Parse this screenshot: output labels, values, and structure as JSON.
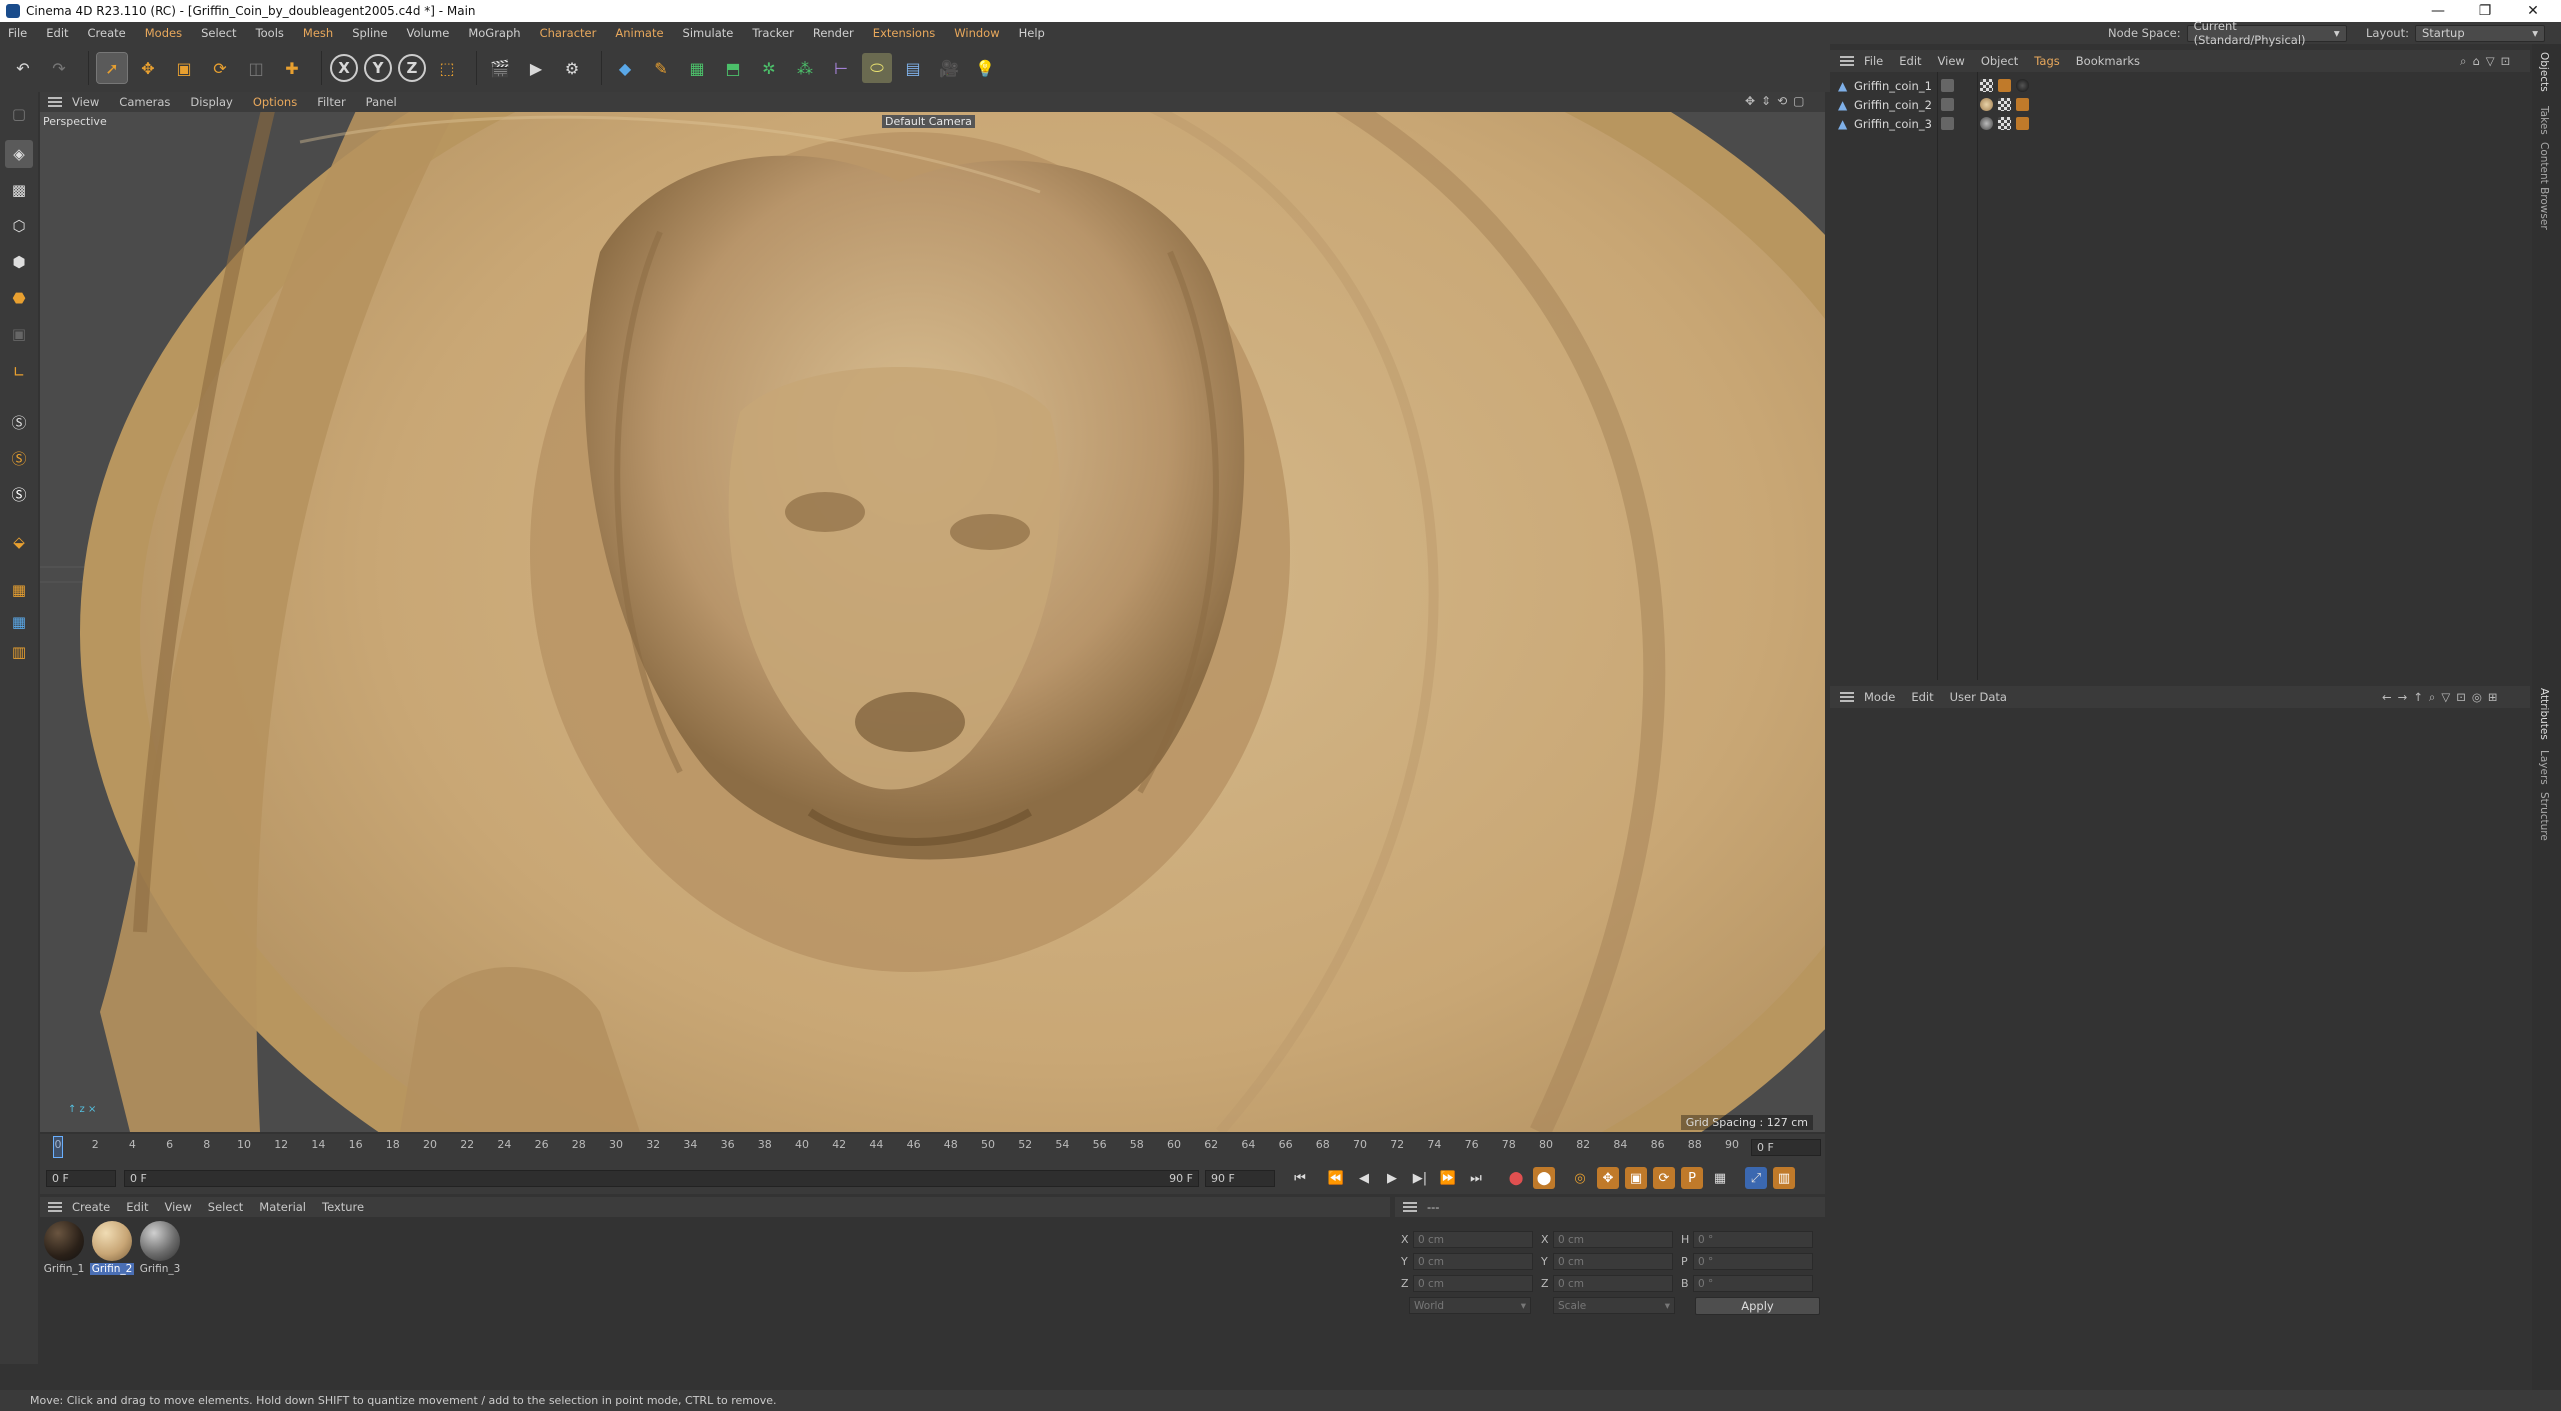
{
  "window": {
    "title": "Cinema 4D R23.110 (RC) - [Griffin_Coin_by_doubleagent2005.c4d *] - Main",
    "controls": {
      "minimize": "—",
      "restore": "❐",
      "close": "✕"
    }
  },
  "menubar": {
    "items": [
      "File",
      "Edit",
      "Create",
      "Modes",
      "Select",
      "Tools",
      "Mesh",
      "Spline",
      "Volume",
      "MoGraph",
      "Character",
      "Animate",
      "Simulate",
      "Tracker",
      "Render",
      "Extensions",
      "Window",
      "Help"
    ],
    "accent_items": [
      "Modes",
      "Mesh",
      "Character",
      "Animate",
      "Extensions",
      "Window"
    ],
    "node_space_label": "Node Space:",
    "node_space_value": "Current (Standard/Physical)",
    "layout_label": "Layout:",
    "layout_value": "Startup"
  },
  "toolbar": {
    "axis_x": "X",
    "axis_y": "Y",
    "axis_z": "Z"
  },
  "viewport": {
    "menu": [
      "View",
      "Cameras",
      "Display",
      "Options",
      "Filter",
      "Panel"
    ],
    "active_menu": "Options",
    "projection": "Perspective",
    "camera": "Default Camera",
    "grid_spacing": "Grid Spacing : 127 cm"
  },
  "timeline": {
    "ticks": [
      "0",
      "2",
      "4",
      "6",
      "8",
      "10",
      "12",
      "14",
      "16",
      "18",
      "20",
      "22",
      "24",
      "26",
      "28",
      "30",
      "32",
      "34",
      "36",
      "38",
      "40",
      "42",
      "44",
      "46",
      "48",
      "50",
      "52",
      "54",
      "56",
      "58",
      "60",
      "62",
      "64",
      "66",
      "68",
      "70",
      "72",
      "74",
      "76",
      "78",
      "80",
      "82",
      "84",
      "86",
      "88",
      "90"
    ],
    "current_frame": "0 F",
    "start_field": "0 F",
    "range_start": "0 F",
    "range_end": "90 F",
    "end_field": "90 F"
  },
  "material_manager": {
    "menu": [
      "Create",
      "Edit",
      "View",
      "Select",
      "Material",
      "Texture"
    ],
    "materials": [
      {
        "name": "Grifin_1",
        "selected": false
      },
      {
        "name": "Grifin_2",
        "selected": true
      },
      {
        "name": "Grifin_3",
        "selected": false
      }
    ]
  },
  "coordinates": {
    "header": "---",
    "col1": {
      "labels": [
        "X",
        "Y",
        "Z"
      ],
      "values": [
        "0 cm",
        "0 cm",
        "0 cm"
      ]
    },
    "col2": {
      "labels": [
        "X",
        "Y",
        "Z"
      ],
      "values": [
        "0 cm",
        "0 cm",
        "0 cm"
      ]
    },
    "col3": {
      "labels": [
        "H",
        "P",
        "B"
      ],
      "values": [
        "0 °",
        "0 °",
        "0 °"
      ]
    },
    "space": "World",
    "mode": "Scale",
    "apply": "Apply"
  },
  "object_manager": {
    "menu": [
      "File",
      "Edit",
      "View",
      "Object",
      "Tags",
      "Bookmarks"
    ],
    "active_menu": "Tags",
    "objects": [
      "Griffin_coin_1",
      "Griffin_coin_2",
      "Griffin_coin_3"
    ]
  },
  "attributes": {
    "menu": [
      "Mode",
      "Edit",
      "User Data"
    ]
  },
  "right_tabs": {
    "top": [
      "Objects",
      "Takes",
      "Content Browser"
    ],
    "bottom": [
      "Attributes",
      "Layers",
      "Structure"
    ]
  },
  "status": "Move: Click and drag to move elements. Hold down SHIFT to quantize movement / add to the selection in point mode, CTRL to remove."
}
